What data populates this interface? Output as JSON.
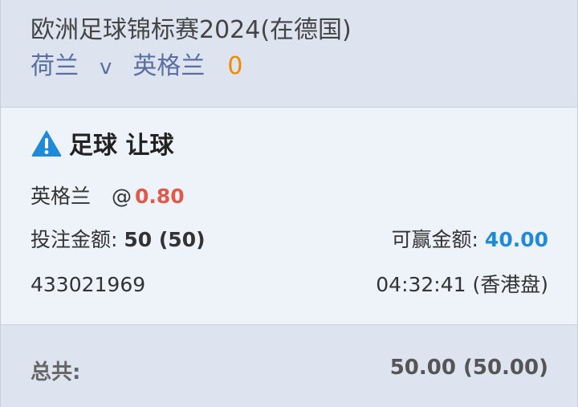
{
  "header": {
    "event_title": "欧洲足球锦标赛2024(在德国)",
    "home_team": "荷兰",
    "vs": "v",
    "away_team": "英格兰",
    "score": "0"
  },
  "bet": {
    "warning_icon": "warning-triangle-icon",
    "bet_type": "足球 让球",
    "selection": "英格兰",
    "at_symbol": "@",
    "odds": "0.80",
    "stake_label": "投注金额:",
    "stake_value": "50 (50)",
    "win_label": "可赢金额:",
    "win_value": "40.00",
    "ticket_id": "433021969",
    "time_odds_type": "04:32:41 (香港盘)"
  },
  "footer": {
    "total_label": "总共:",
    "total_value": "50.00 (50.00)"
  },
  "colors": {
    "accent_blue": "#1e8ad8",
    "odds_red": "#e05a4a",
    "score_orange": "#f08a00",
    "team_blue": "#5a6fa0"
  }
}
